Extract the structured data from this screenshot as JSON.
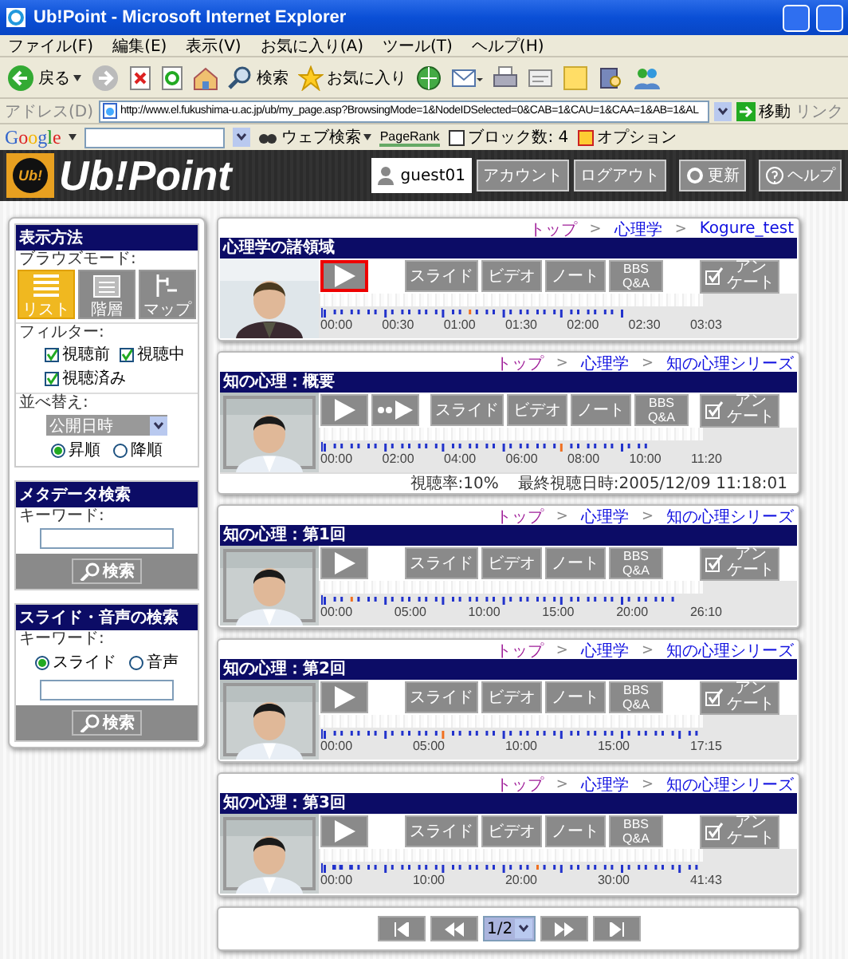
{
  "window": {
    "title": "Ub!Point - Microsoft Internet Explorer"
  },
  "menu": [
    "ファイル(F)",
    "編集(E)",
    "表示(V)",
    "お気に入り(A)",
    "ツール(T)",
    "ヘルプ(H)"
  ],
  "toolbar": [
    {
      "kind": "back",
      "label": "戻る"
    },
    {
      "kind": "forward"
    },
    {
      "kind": "stop"
    },
    {
      "kind": "refresh"
    },
    {
      "kind": "home"
    },
    {
      "kind": "search",
      "label": "検索"
    },
    {
      "kind": "favorites",
      "label": "お気に入り"
    },
    {
      "kind": "media"
    },
    {
      "kind": "mail"
    },
    {
      "kind": "print"
    },
    {
      "kind": "edit"
    },
    {
      "kind": "note"
    },
    {
      "kind": "research"
    },
    {
      "kind": "messenger"
    }
  ],
  "address": {
    "label": "アドレス(D)",
    "url": "http://www.el.fukushima-u.ac.jp/ub/my_page.asp?BrowsingMode=1&NodeIDSelected=0&CAB=1&CAU=1&CAA=1&AB=1&AL",
    "go": "移動",
    "links": "リンク"
  },
  "google_bar": {
    "logo": "Google",
    "search": "ウェブ検索",
    "pagerank": "PageRank",
    "blocked": "ブロック数: 4",
    "options": "オプション"
  },
  "header": {
    "badge": "Ub!",
    "logo": "Ub!Point",
    "user": "guest01",
    "buttons": [
      {
        "kind": "account",
        "label": "アカウント"
      },
      {
        "kind": "logout",
        "label": "ログアウト"
      },
      {
        "kind": "refresh",
        "label": "更新"
      },
      {
        "kind": "help",
        "label": "ヘルプ"
      }
    ]
  },
  "sidebar": {
    "display": {
      "title": "表示方法",
      "mode_label": "ブラウズモード:",
      "modes": [
        {
          "kind": "list",
          "label": "リスト",
          "selected": true
        },
        {
          "kind": "tree",
          "label": "階層",
          "selected": false
        },
        {
          "kind": "map",
          "label": "マップ",
          "selected": false
        }
      ],
      "filter_label": "フィルター:",
      "filters": [
        {
          "label": "視聴前",
          "checked": true
        },
        {
          "label": "視聴中",
          "checked": true
        },
        {
          "label": "視聴済み",
          "checked": true
        }
      ],
      "sort_label": "並べ替え:",
      "sort_value": "公開日時",
      "orders": [
        {
          "label": "昇順",
          "selected": true
        },
        {
          "label": "降順",
          "selected": false
        }
      ]
    },
    "metadata_search": {
      "title": "メタデータ検索",
      "keyword_label": "キーワード:",
      "button": "検索"
    },
    "media_search": {
      "title": "スライド・音声の検索",
      "keyword_label": "キーワード:",
      "targets": [
        {
          "label": "スライド",
          "selected": true
        },
        {
          "label": "音声",
          "selected": false
        }
      ],
      "button": "検索"
    }
  },
  "cards": [
    {
      "crumbs": [
        {
          "kind": "link",
          "label": "トップ",
          "visited": true
        },
        {
          "kind": "separator",
          "label": ">"
        },
        {
          "kind": "link",
          "label": "心理学",
          "visited": false
        },
        {
          "kind": "separator",
          "label": ">"
        },
        {
          "kind": "link",
          "label": "Kogure_test",
          "visited": false
        }
      ],
      "title": "心理学の諸領域",
      "buttons": [
        {
          "kind": "play",
          "highlighted": true
        },
        {
          "kind": "slide",
          "label": "スライド"
        },
        {
          "kind": "video",
          "label": "ビデオ"
        },
        {
          "kind": "note",
          "label": "ノート"
        },
        {
          "kind": "bbs",
          "lines": [
            "BBS",
            "Q&A"
          ]
        },
        {
          "kind": "survey",
          "lines": [
            "アン",
            "ケート"
          ]
        }
      ],
      "times": [
        "00:00",
        "00:30",
        "01:00",
        "01:30",
        "02:00",
        "02:30",
        "03:03"
      ]
    },
    {
      "crumbs": [
        {
          "kind": "link",
          "label": "トップ",
          "visited": true
        },
        {
          "kind": "separator",
          "label": ">"
        },
        {
          "kind": "link",
          "label": "心理学",
          "visited": false
        },
        {
          "kind": "separator",
          "label": ">"
        },
        {
          "kind": "link",
          "label": "知の心理シリーズ",
          "visited": false
        }
      ],
      "title": "知の心理：概要",
      "buttons": [
        {
          "kind": "play",
          "highlighted": false
        },
        {
          "kind": "fastplay"
        },
        {
          "kind": "slide",
          "label": "スライド"
        },
        {
          "kind": "video",
          "label": "ビデオ"
        },
        {
          "kind": "note",
          "label": "ノート"
        },
        {
          "kind": "bbs",
          "lines": [
            "BBS",
            "Q&A"
          ]
        },
        {
          "kind": "survey",
          "lines": [
            "アン",
            "ケート"
          ]
        }
      ],
      "times": [
        "00:00",
        "02:00",
        "04:00",
        "06:00",
        "08:00",
        "10:00",
        "11:20"
      ],
      "stats": [
        "視聴率:10%",
        "最終視聴日時:2005/12/09 11:18:01"
      ]
    },
    {
      "crumbs": [
        {
          "kind": "link",
          "label": "トップ",
          "visited": true
        },
        {
          "kind": "separator",
          "label": ">"
        },
        {
          "kind": "link",
          "label": "心理学",
          "visited": false
        },
        {
          "kind": "separator",
          "label": ">"
        },
        {
          "kind": "link",
          "label": "知の心理シリーズ",
          "visited": false
        }
      ],
      "title": "知の心理：第1回",
      "buttons": [
        {
          "kind": "play",
          "highlighted": false
        },
        {
          "kind": "slide",
          "label": "スライド"
        },
        {
          "kind": "video",
          "label": "ビデオ"
        },
        {
          "kind": "note",
          "label": "ノート"
        },
        {
          "kind": "bbs",
          "lines": [
            "BBS",
            "Q&A"
          ]
        },
        {
          "kind": "survey",
          "lines": [
            "アン",
            "ケート"
          ]
        }
      ],
      "times": [
        "00:00",
        "05:00",
        "10:00",
        "15:00",
        "20:00",
        "26:10"
      ]
    },
    {
      "crumbs": [
        {
          "kind": "link",
          "label": "トップ",
          "visited": true
        },
        {
          "kind": "separator",
          "label": ">"
        },
        {
          "kind": "link",
          "label": "心理学",
          "visited": false
        },
        {
          "kind": "separator",
          "label": ">"
        },
        {
          "kind": "link",
          "label": "知の心理シリーズ",
          "visited": false
        }
      ],
      "title": "知の心理：第2回",
      "buttons": [
        {
          "kind": "play",
          "highlighted": false
        },
        {
          "kind": "slide",
          "label": "スライド"
        },
        {
          "kind": "video",
          "label": "ビデオ"
        },
        {
          "kind": "note",
          "label": "ノート"
        },
        {
          "kind": "bbs",
          "lines": [
            "BBS",
            "Q&A"
          ]
        },
        {
          "kind": "survey",
          "lines": [
            "アン",
            "ケート"
          ]
        }
      ],
      "times": [
        "00:00",
        "05:00",
        "10:00",
        "15:00",
        "17:15"
      ]
    },
    {
      "crumbs": [
        {
          "kind": "link",
          "label": "トップ",
          "visited": true
        },
        {
          "kind": "separator",
          "label": ">"
        },
        {
          "kind": "link",
          "label": "心理学",
          "visited": false
        },
        {
          "kind": "separator",
          "label": ">"
        },
        {
          "kind": "link",
          "label": "知の心理シリーズ",
          "visited": false
        }
      ],
      "title": "知の心理：第3回",
      "buttons": [
        {
          "kind": "play",
          "highlighted": false
        },
        {
          "kind": "slide",
          "label": "スライド"
        },
        {
          "kind": "video",
          "label": "ビデオ"
        },
        {
          "kind": "note",
          "label": "ノート"
        },
        {
          "kind": "bbs",
          "lines": [
            "BBS",
            "Q&A"
          ]
        },
        {
          "kind": "survey",
          "lines": [
            "アン",
            "ケート"
          ]
        }
      ],
      "times": [
        "00:00",
        "10:00",
        "20:00",
        "30:00",
        "41:43"
      ]
    }
  ],
  "pager": {
    "page": "1/2"
  }
}
